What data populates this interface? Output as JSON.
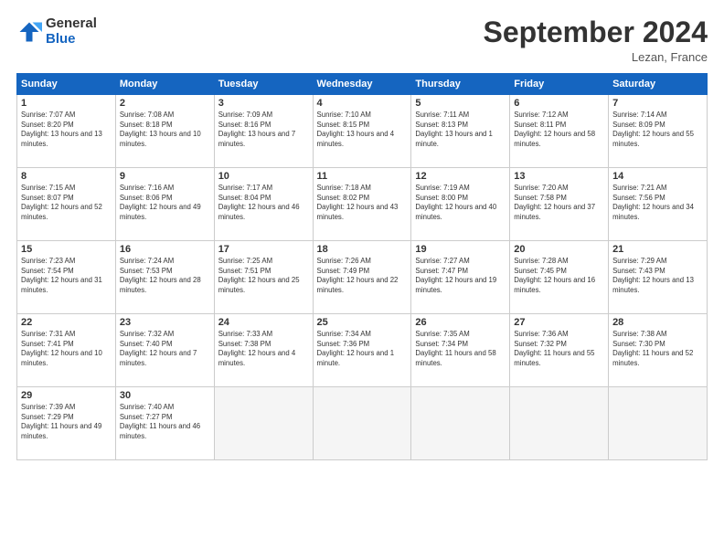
{
  "logo": {
    "general": "General",
    "blue": "Blue"
  },
  "header": {
    "title": "September 2024",
    "location": "Lezan, France"
  },
  "weekdays": [
    "Sunday",
    "Monday",
    "Tuesday",
    "Wednesday",
    "Thursday",
    "Friday",
    "Saturday"
  ],
  "weeks": [
    [
      {
        "day": "1",
        "sunrise": "Sunrise: 7:07 AM",
        "sunset": "Sunset: 8:20 PM",
        "daylight": "Daylight: 13 hours and 13 minutes."
      },
      {
        "day": "2",
        "sunrise": "Sunrise: 7:08 AM",
        "sunset": "Sunset: 8:18 PM",
        "daylight": "Daylight: 13 hours and 10 minutes."
      },
      {
        "day": "3",
        "sunrise": "Sunrise: 7:09 AM",
        "sunset": "Sunset: 8:16 PM",
        "daylight": "Daylight: 13 hours and 7 minutes."
      },
      {
        "day": "4",
        "sunrise": "Sunrise: 7:10 AM",
        "sunset": "Sunset: 8:15 PM",
        "daylight": "Daylight: 13 hours and 4 minutes."
      },
      {
        "day": "5",
        "sunrise": "Sunrise: 7:11 AM",
        "sunset": "Sunset: 8:13 PM",
        "daylight": "Daylight: 13 hours and 1 minute."
      },
      {
        "day": "6",
        "sunrise": "Sunrise: 7:12 AM",
        "sunset": "Sunset: 8:11 PM",
        "daylight": "Daylight: 12 hours and 58 minutes."
      },
      {
        "day": "7",
        "sunrise": "Sunrise: 7:14 AM",
        "sunset": "Sunset: 8:09 PM",
        "daylight": "Daylight: 12 hours and 55 minutes."
      }
    ],
    [
      {
        "day": "8",
        "sunrise": "Sunrise: 7:15 AM",
        "sunset": "Sunset: 8:07 PM",
        "daylight": "Daylight: 12 hours and 52 minutes."
      },
      {
        "day": "9",
        "sunrise": "Sunrise: 7:16 AM",
        "sunset": "Sunset: 8:06 PM",
        "daylight": "Daylight: 12 hours and 49 minutes."
      },
      {
        "day": "10",
        "sunrise": "Sunrise: 7:17 AM",
        "sunset": "Sunset: 8:04 PM",
        "daylight": "Daylight: 12 hours and 46 minutes."
      },
      {
        "day": "11",
        "sunrise": "Sunrise: 7:18 AM",
        "sunset": "Sunset: 8:02 PM",
        "daylight": "Daylight: 12 hours and 43 minutes."
      },
      {
        "day": "12",
        "sunrise": "Sunrise: 7:19 AM",
        "sunset": "Sunset: 8:00 PM",
        "daylight": "Daylight: 12 hours and 40 minutes."
      },
      {
        "day": "13",
        "sunrise": "Sunrise: 7:20 AM",
        "sunset": "Sunset: 7:58 PM",
        "daylight": "Daylight: 12 hours and 37 minutes."
      },
      {
        "day": "14",
        "sunrise": "Sunrise: 7:21 AM",
        "sunset": "Sunset: 7:56 PM",
        "daylight": "Daylight: 12 hours and 34 minutes."
      }
    ],
    [
      {
        "day": "15",
        "sunrise": "Sunrise: 7:23 AM",
        "sunset": "Sunset: 7:54 PM",
        "daylight": "Daylight: 12 hours and 31 minutes."
      },
      {
        "day": "16",
        "sunrise": "Sunrise: 7:24 AM",
        "sunset": "Sunset: 7:53 PM",
        "daylight": "Daylight: 12 hours and 28 minutes."
      },
      {
        "day": "17",
        "sunrise": "Sunrise: 7:25 AM",
        "sunset": "Sunset: 7:51 PM",
        "daylight": "Daylight: 12 hours and 25 minutes."
      },
      {
        "day": "18",
        "sunrise": "Sunrise: 7:26 AM",
        "sunset": "Sunset: 7:49 PM",
        "daylight": "Daylight: 12 hours and 22 minutes."
      },
      {
        "day": "19",
        "sunrise": "Sunrise: 7:27 AM",
        "sunset": "Sunset: 7:47 PM",
        "daylight": "Daylight: 12 hours and 19 minutes."
      },
      {
        "day": "20",
        "sunrise": "Sunrise: 7:28 AM",
        "sunset": "Sunset: 7:45 PM",
        "daylight": "Daylight: 12 hours and 16 minutes."
      },
      {
        "day": "21",
        "sunrise": "Sunrise: 7:29 AM",
        "sunset": "Sunset: 7:43 PM",
        "daylight": "Daylight: 12 hours and 13 minutes."
      }
    ],
    [
      {
        "day": "22",
        "sunrise": "Sunrise: 7:31 AM",
        "sunset": "Sunset: 7:41 PM",
        "daylight": "Daylight: 12 hours and 10 minutes."
      },
      {
        "day": "23",
        "sunrise": "Sunrise: 7:32 AM",
        "sunset": "Sunset: 7:40 PM",
        "daylight": "Daylight: 12 hours and 7 minutes."
      },
      {
        "day": "24",
        "sunrise": "Sunrise: 7:33 AM",
        "sunset": "Sunset: 7:38 PM",
        "daylight": "Daylight: 12 hours and 4 minutes."
      },
      {
        "day": "25",
        "sunrise": "Sunrise: 7:34 AM",
        "sunset": "Sunset: 7:36 PM",
        "daylight": "Daylight: 12 hours and 1 minute."
      },
      {
        "day": "26",
        "sunrise": "Sunrise: 7:35 AM",
        "sunset": "Sunset: 7:34 PM",
        "daylight": "Daylight: 11 hours and 58 minutes."
      },
      {
        "day": "27",
        "sunrise": "Sunrise: 7:36 AM",
        "sunset": "Sunset: 7:32 PM",
        "daylight": "Daylight: 11 hours and 55 minutes."
      },
      {
        "day": "28",
        "sunrise": "Sunrise: 7:38 AM",
        "sunset": "Sunset: 7:30 PM",
        "daylight": "Daylight: 11 hours and 52 minutes."
      }
    ],
    [
      {
        "day": "29",
        "sunrise": "Sunrise: 7:39 AM",
        "sunset": "Sunset: 7:29 PM",
        "daylight": "Daylight: 11 hours and 49 minutes."
      },
      {
        "day": "30",
        "sunrise": "Sunrise: 7:40 AM",
        "sunset": "Sunset: 7:27 PM",
        "daylight": "Daylight: 11 hours and 46 minutes."
      },
      null,
      null,
      null,
      null,
      null
    ]
  ]
}
